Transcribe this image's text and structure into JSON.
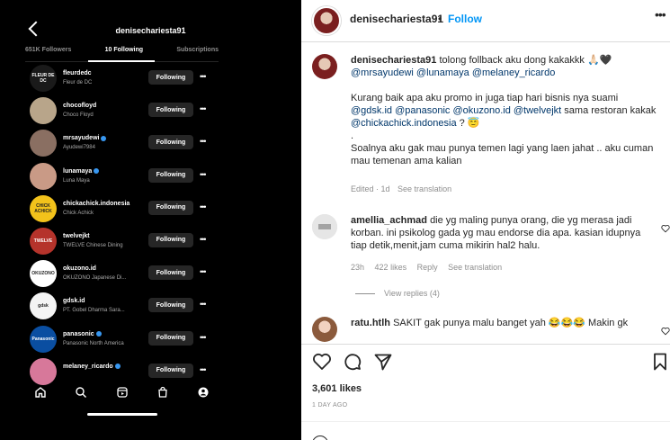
{
  "left_screenshot": {
    "username": "denisechariesta91",
    "tabs": [
      "651K Followers",
      "10 Following",
      "Subscriptions"
    ],
    "follow_button_label": "Following",
    "more_label": "•••",
    "following": [
      {
        "username": "fleurdedc",
        "subtitle": "Fleur de DC",
        "verified": false,
        "avatar_color": "#1a1a1a",
        "avatar_text": "FLEUR DE DC"
      },
      {
        "username": "chocofloyd",
        "subtitle": "Choco Floyd",
        "verified": false,
        "avatar_color": "#b8a58a",
        "avatar_text": ""
      },
      {
        "username": "mrsayudewi",
        "subtitle": "Ayudewi7984",
        "verified": true,
        "avatar_color": "#8a6f62",
        "avatar_text": ""
      },
      {
        "username": "lunamaya",
        "subtitle": "Luna Maya",
        "verified": true,
        "avatar_color": "#c99a86",
        "avatar_text": ""
      },
      {
        "username": "chickachick.indonesia",
        "subtitle": "Chick Achick",
        "verified": false,
        "avatar_color": "#f2c21b",
        "avatar_text": "CHICK ACHICK"
      },
      {
        "username": "twelvejkt",
        "subtitle": "TWELVE Chinese Dining",
        "verified": false,
        "avatar_color": "#b5332b",
        "avatar_text": "TWELVE"
      },
      {
        "username": "okuzono.id",
        "subtitle": "OKUZONO Japanese Di...",
        "verified": false,
        "avatar_color": "#ffffff",
        "avatar_text": "OKUZONO"
      },
      {
        "username": "gdsk.id",
        "subtitle": "PT. Gobel Dharma Sara...",
        "verified": false,
        "avatar_color": "#f4f4f4",
        "avatar_text": "gdsk"
      },
      {
        "username": "panasonic",
        "subtitle": "Panasonic North America",
        "verified": true,
        "avatar_color": "#0a4ea1",
        "avatar_text": "Panasonic"
      },
      {
        "username": "melaney_ricardo",
        "subtitle": "",
        "verified": true,
        "avatar_color": "#d7789a",
        "avatar_text": ""
      }
    ],
    "nav_icons": [
      "home-icon",
      "search-icon",
      "reels-icon",
      "shop-icon",
      "profile-icon"
    ]
  },
  "header": {
    "username": "denisechariesta91",
    "separator": "•",
    "follow_label": "Follow",
    "more_label": "•••"
  },
  "caption": {
    "username": "denisechariesta91",
    "line1": "tolong follback aku dong kakakkk 🙏🏻🖤",
    "mentions1": "@mrsayudewi @lunamaya @melaney_ricardo",
    "para2_text": "Kurang baik apa aku promo in juga tiap hari bisnis nya suami",
    "mentions2a": "@gdsk.id @panasonic @okuzono.id @twelvejkt",
    "para2_mid": "sama restoran kakak",
    "mentions2b": "@chickachick.indonesia",
    "para2_end": "? 😇",
    "dot": ".",
    "para3": "Soalnya aku gak mau punya temen lagi yang laen jahat .. aku cuman mau temenan ama kalian",
    "meta_edited": "Edited · 1d",
    "meta_translate": "See translation"
  },
  "comments": [
    {
      "username": "amellia_achmad",
      "text": "die yg maling punya orang, die yg merasa jadi korban. ini psikolog gada yg mau endorse dia apa. kasian idupnya tiap detik,menit,jam cuma mikirin hal2 halu.",
      "time": "23h",
      "likes": "422 likes",
      "reply": "Reply",
      "translate": "See translation",
      "view_replies": "View replies (4)"
    },
    {
      "username": "ratu.htlh",
      "text": "SAKIT gak punya malu banget yah 😂😂😂 Makin gk"
    }
  ],
  "post": {
    "likes": "3,601 likes",
    "ago": "1 DAY AGO"
  }
}
